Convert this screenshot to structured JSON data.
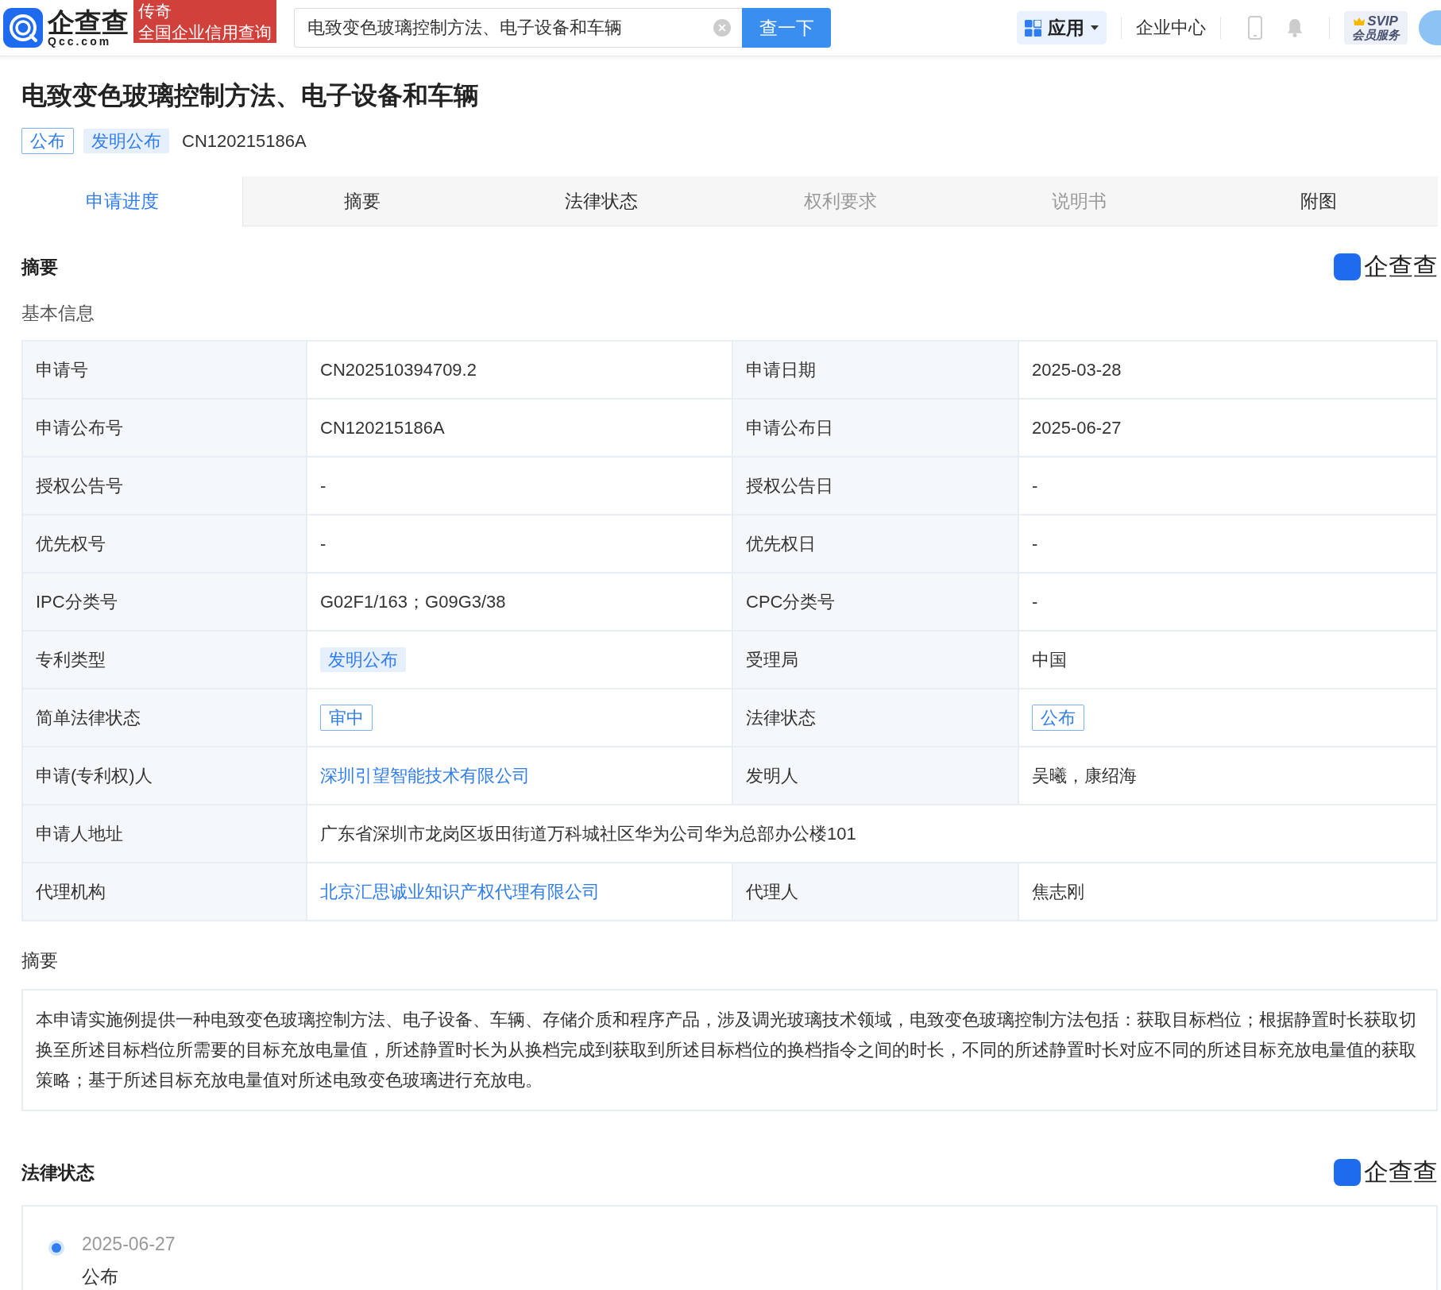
{
  "header": {
    "logo": {
      "name": "企查查",
      "domain": "Qcc.com"
    },
    "banner": [
      "传奇",
      "全国企业信用查询"
    ],
    "search": {
      "value": "电致变色玻璃控制方法、电子设备和车辆",
      "button": "查一下"
    },
    "apps_button": "应用",
    "enterprise_center": "企业中心",
    "vip": {
      "title": "SVIP",
      "subtitle": "会员服务"
    }
  },
  "title": "电致变色玻璃控制方法、电子设备和车辆",
  "tags": [
    {
      "label": "公布",
      "kind": "outline"
    },
    {
      "label": "发明公布",
      "kind": "fill"
    }
  ],
  "publication_number": "CN120215186A",
  "tabs": [
    {
      "label": "申请进度",
      "selected": true,
      "disabled": false
    },
    {
      "label": "摘要",
      "selected": false,
      "disabled": false
    },
    {
      "label": "法律状态",
      "selected": false,
      "disabled": false
    },
    {
      "label": "权利要求",
      "selected": false,
      "disabled": true
    },
    {
      "label": "说明书",
      "selected": false,
      "disabled": true
    },
    {
      "label": "附图",
      "selected": false,
      "disabled": false
    }
  ],
  "summary_section": {
    "title": "摘要",
    "brand": "企查查",
    "subtitle": "基本信息"
  },
  "info_rows": [
    [
      {
        "label": "申请号",
        "value": "CN202510394709.2",
        "kind": "text"
      },
      {
        "label": "申请日期",
        "value": "2025-03-28",
        "kind": "text"
      }
    ],
    [
      {
        "label": "申请公布号",
        "value": "CN120215186A",
        "kind": "text"
      },
      {
        "label": "申请公布日",
        "value": "2025-06-27",
        "kind": "text"
      }
    ],
    [
      {
        "label": "授权公告号",
        "value": "-",
        "kind": "text"
      },
      {
        "label": "授权公告日",
        "value": "-",
        "kind": "text"
      }
    ],
    [
      {
        "label": "优先权号",
        "value": "-",
        "kind": "text"
      },
      {
        "label": "优先权日",
        "value": "-",
        "kind": "text"
      }
    ],
    [
      {
        "label": "IPC分类号",
        "value": "G02F1/163；G09G3/38",
        "kind": "text"
      },
      {
        "label": "CPC分类号",
        "value": "-",
        "kind": "text"
      }
    ],
    [
      {
        "label": "专利类型",
        "value": "发明公布",
        "kind": "fill"
      },
      {
        "label": "受理局",
        "value": "中国",
        "kind": "text"
      }
    ],
    [
      {
        "label": "简单法律状态",
        "value": "审中",
        "kind": "outline"
      },
      {
        "label": "法律状态",
        "value": "公布",
        "kind": "outline"
      }
    ],
    [
      {
        "label": "申请(专利权)人",
        "value": "深圳引望智能技术有限公司",
        "kind": "link"
      },
      {
        "label": "发明人",
        "value": "吴曦，康绍海",
        "kind": "text"
      }
    ],
    [
      {
        "label": "申请人地址",
        "value": "广东省深圳市龙岗区坂田街道万科城社区华为公司华为总部办公楼101",
        "kind": "text"
      }
    ],
    [
      {
        "label": "代理机构",
        "value": "北京汇思诚业知识产权代理有限公司",
        "kind": "link"
      },
      {
        "label": "代理人",
        "value": "焦志刚",
        "kind": "text"
      }
    ]
  ],
  "abstract": {
    "title": "摘要",
    "text": "本申请实施例提供一种电致变色玻璃控制方法、电子设备、车辆、存储介质和程序产品，涉及调光玻璃技术领域，电致变色玻璃控制方法包括：获取目标档位；根据静置时长获取切换至所述目标档位所需要的目标充放电量值，所述静置时长为从换档完成到获取到所述目标档位的换档指令之间的时长，不同的所述静置时长对应不同的所述目标充放电量值的获取策略；基于所述目标充放电量值对所述电致变色玻璃进行充放电。"
  },
  "legal_section": {
    "title": "法律状态",
    "brand": "企查查",
    "events": [
      {
        "date": "2025-06-27",
        "status": "公布"
      }
    ]
  }
}
